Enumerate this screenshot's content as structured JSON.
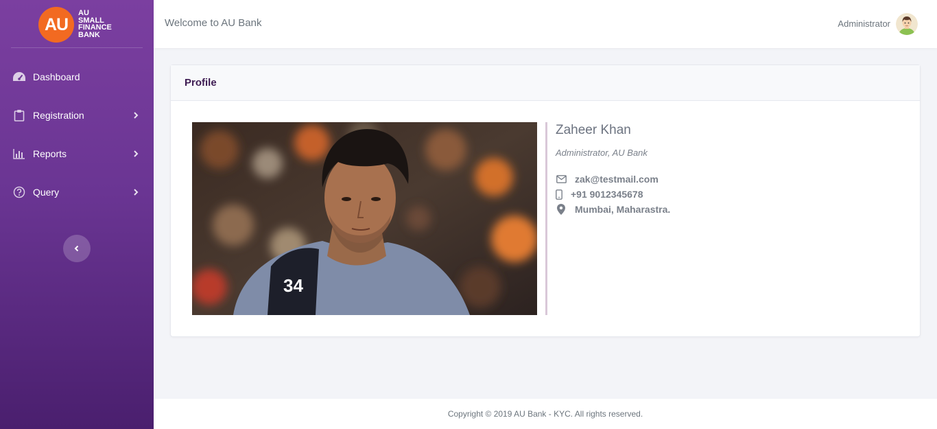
{
  "brand": {
    "logo_mark": "AU",
    "logo_lines": [
      "AU",
      "SMALL",
      "FINANCE",
      "BANK"
    ]
  },
  "sidebar": {
    "items": [
      {
        "label": "Dashboard",
        "icon": "dashboard-icon",
        "has_submenu": false
      },
      {
        "label": "Registration",
        "icon": "clipboard-icon",
        "has_submenu": true
      },
      {
        "label": "Reports",
        "icon": "bar-chart-icon",
        "has_submenu": true
      },
      {
        "label": "Query",
        "icon": "question-circle-icon",
        "has_submenu": true
      }
    ]
  },
  "header": {
    "welcome": "Welcome to AU Bank",
    "user": "Administrator"
  },
  "profile": {
    "title": "Profile",
    "name": "Zaheer Khan",
    "role": "Administrator, AU Bank",
    "email": "zak@testmail.com",
    "phone": "+91 9012345678",
    "location": "Mumbai, Maharastra."
  },
  "footer": {
    "copyright": "Copyright © 2019 AU Bank - KYC. All rights reserved."
  },
  "colors": {
    "sidebar_top": "#7b3fa0",
    "sidebar_bottom": "#4a1f6e",
    "logo_orange": "#f26a21",
    "card_title": "#3d1b52",
    "accent_divider": "#d9c8d8"
  }
}
